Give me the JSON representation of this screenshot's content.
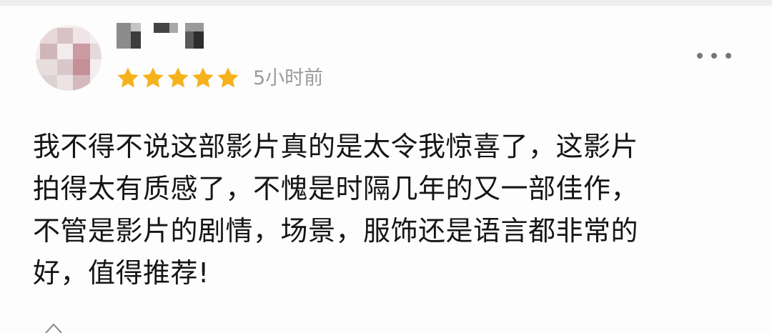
{
  "comment": {
    "time_ago": "5小时前",
    "rating": 5,
    "review_text": "我不得不说这部影片真的是太令我惊喜了，这影片\n拍得太有质感了，不愧是时隔几年的又一部佳作，\n不管是影片的剧情，场景，服饰还是语言都非常的\n好，值得推荐!"
  },
  "colors": {
    "star": "#f5b21c",
    "time_text": "#9c9c9c",
    "review_text": "#151515"
  },
  "icons": {
    "more": "more-horizontal-icon",
    "star": "star-icon"
  }
}
